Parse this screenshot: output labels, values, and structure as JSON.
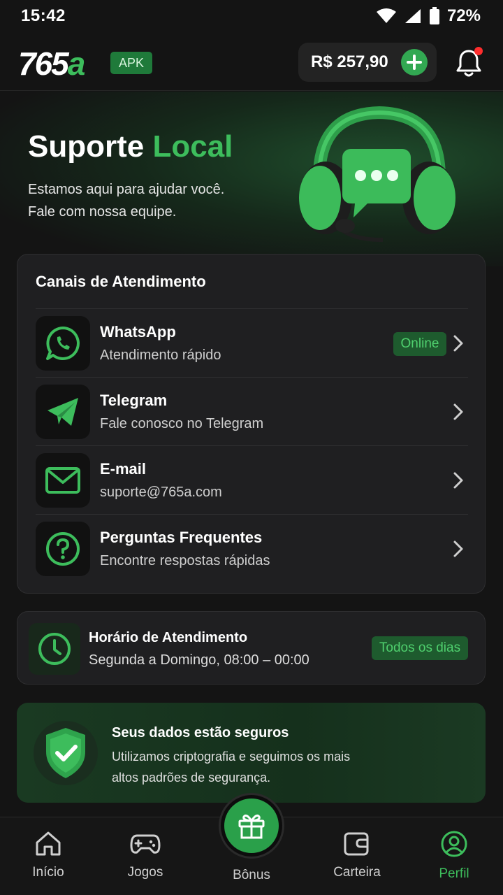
{
  "status_bar": {
    "time": "15:42",
    "battery": "72%"
  },
  "header": {
    "logo_number": "765",
    "logo_letter": "a",
    "apk_badge": "APK",
    "balance": "R$ 257,90"
  },
  "hero": {
    "title_white": "Suporte",
    "title_green": "Local",
    "subtitle_line1": "Estamos aqui para ajudar você.",
    "subtitle_line2": "Fale com nossa equipe."
  },
  "channels": {
    "title": "Canais de Atendimento",
    "items": [
      {
        "name": "WhatsApp",
        "desc": "Atendimento rápido",
        "badge": "Online",
        "icon": "whatsapp-icon"
      },
      {
        "name": "Telegram",
        "desc": "Fale conosco no Telegram",
        "icon": "telegram-icon"
      },
      {
        "name": "E-mail",
        "desc": "suporte@765a.com",
        "icon": "mail-icon"
      },
      {
        "name": "Perguntas Frequentes",
        "desc": "Encontre respostas rápidas",
        "icon": "question-icon"
      }
    ]
  },
  "hours": {
    "title": "Horário de Atendimento",
    "schedule": "Segunda a Domingo, 08:00 – 00:00",
    "badge": "Todos os dias"
  },
  "security": {
    "title": "Seus dados estão seguros",
    "line1": "Utilizamos criptografia e seguimos os mais",
    "line2": "altos padrões de segurança."
  },
  "nav": {
    "items": [
      {
        "label": "Início",
        "icon": "home-icon"
      },
      {
        "label": "Jogos",
        "icon": "gamepad-icon"
      },
      {
        "label": "Bônus",
        "icon": "gift-icon"
      },
      {
        "label": "Carteira",
        "icon": "wallet-icon"
      },
      {
        "label": "Perfil",
        "icon": "profile-icon",
        "active": true
      }
    ]
  },
  "colors": {
    "accent": "#3dbd5c",
    "background": "#141414",
    "card": "#1f1f21",
    "badge_bg": "#1e5b2e"
  }
}
